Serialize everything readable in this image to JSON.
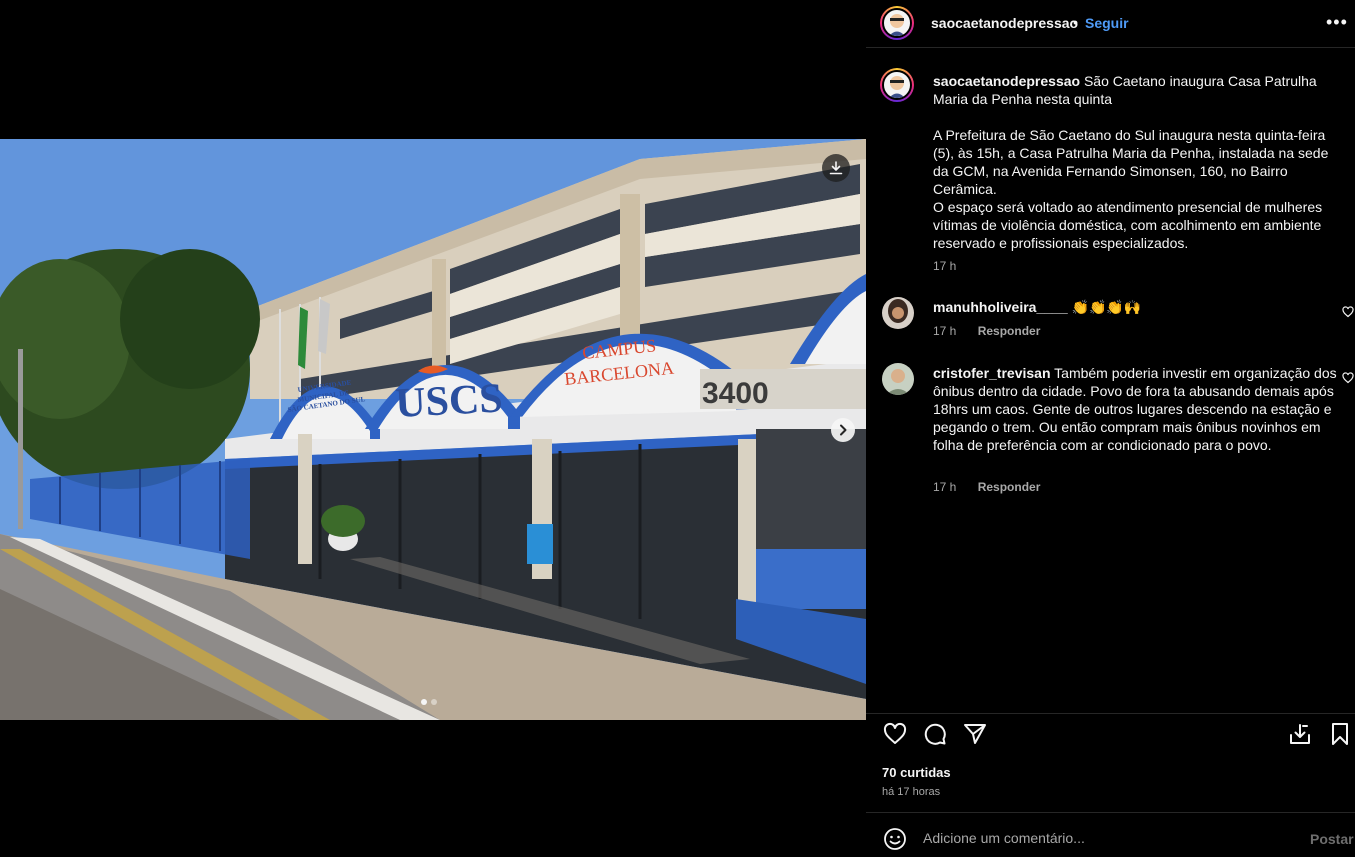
{
  "post": {
    "username": "saocaetanodepressao",
    "separator": "•",
    "follow_label": "Seguir",
    "more_label": "•••",
    "caption_title": "São Caetano inaugura Casa Patrulha Maria da Penha nesta quinta",
    "caption_p1": "A Prefeitura de São Caetano do Sul inaugura nesta quinta-feira (5), às 15h, a Casa Patrulha Maria da Penha, instalada na sede da GCM, na Avenida Fernando Simonsen, 160, no Bairro Cerâmica.",
    "caption_p2": "O espaço será voltado ao atendimento presencial de mulheres vítimas de violência doméstica, com acolhimento em ambiente reservado e profissionais especializados.",
    "caption_time": "17 h",
    "likes": "70 curtidas",
    "posted_ago": "há 17 horas"
  },
  "photo": {
    "sign_main": "USCS",
    "sign_university": [
      "UNIVERSIDADE",
      "MUNICIPAL DE",
      "SÃO CAETANO DO SUL"
    ],
    "sign_campus": [
      "CAMPUS",
      "BARCELONA"
    ],
    "sign_number": "3400",
    "carousel_index": 1,
    "carousel_total": 2
  },
  "comments": [
    {
      "username": "manuhholiveira____",
      "text": "👏👏👏🙌",
      "time": "17 h",
      "reply_label": "Responder"
    },
    {
      "username": "cristofer_trevisan",
      "text": "Também poderia investir em organização dos ônibus dentro da cidade. Povo de fora ta abusando demais após 18hrs um caos. Gente de outros lugares descendo na estação e pegando o trem. Ou então compram mais ônibus novinhos em folha de preferência com ar condicionado para o povo.",
      "time": "17 h",
      "reply_label": "Responder"
    }
  ],
  "comment_box": {
    "placeholder": "Adicione um comentário...",
    "post_label": "Postar"
  },
  "icons": [
    "download-icon",
    "chevron-right-icon",
    "more-icon",
    "heart-icon",
    "comment-icon",
    "share-icon",
    "save-post-icon",
    "bookmark-icon",
    "emoji-icon"
  ],
  "colors": {
    "accent": "#4f9bf7",
    "background": "#000000",
    "muted": "#a8a8a8",
    "text": "#f5f5f5"
  }
}
